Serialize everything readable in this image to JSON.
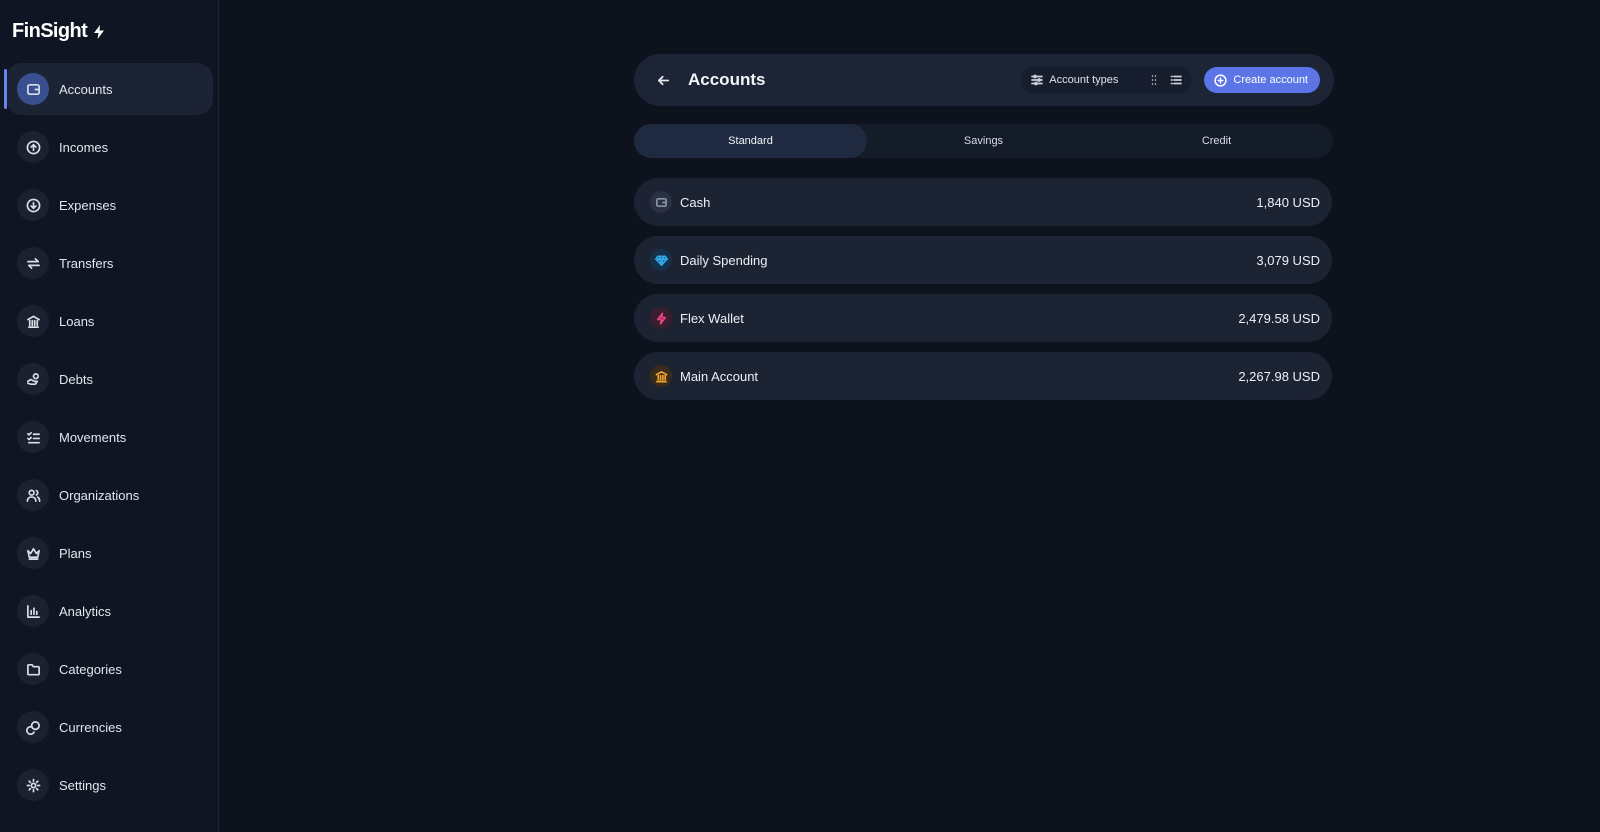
{
  "app": {
    "name": "FinSight"
  },
  "sidebar": {
    "items": [
      {
        "label": "Accounts",
        "icon": "wallet-icon",
        "active": true
      },
      {
        "label": "Incomes",
        "icon": "arrow-up-circle-icon"
      },
      {
        "label": "Expenses",
        "icon": "arrow-down-circle-icon"
      },
      {
        "label": "Transfers",
        "icon": "transfer-icon"
      },
      {
        "label": "Loans",
        "icon": "bank-icon"
      },
      {
        "label": "Debts",
        "icon": "hand-coins-icon"
      },
      {
        "label": "Movements",
        "icon": "checklist-icon"
      },
      {
        "label": "Organizations",
        "icon": "users-icon"
      },
      {
        "label": "Plans",
        "icon": "crown-icon"
      },
      {
        "label": "Analytics",
        "icon": "bar-chart-icon"
      },
      {
        "label": "Categories",
        "icon": "folder-icon"
      },
      {
        "label": "Currencies",
        "icon": "coins-icon"
      },
      {
        "label": "Settings",
        "icon": "gear-icon"
      }
    ]
  },
  "header": {
    "title": "Accounts",
    "account_types_label": "Account types",
    "create_label": "Create account"
  },
  "tabs": [
    {
      "label": "Standard",
      "active": true
    },
    {
      "label": "Savings"
    },
    {
      "label": "Credit"
    }
  ],
  "accounts": [
    {
      "name": "Cash",
      "amount": "1,840 USD",
      "icon": "wallet-icon",
      "color": "#8a93a6"
    },
    {
      "name": "Daily Spending",
      "amount": "3,079 USD",
      "icon": "diamond-icon",
      "color": "#2fa8e8"
    },
    {
      "name": "Flex Wallet",
      "amount": "2,479.58 USD",
      "icon": "lightning-icon",
      "color": "#e8467c"
    },
    {
      "name": "Main Account",
      "amount": "2,267.98 USD",
      "icon": "bank-icon",
      "color": "#f2a12e"
    }
  ],
  "colors": {
    "accent": "#5b75e6",
    "background": "#0d121c",
    "sidebar": "#0f1522"
  }
}
